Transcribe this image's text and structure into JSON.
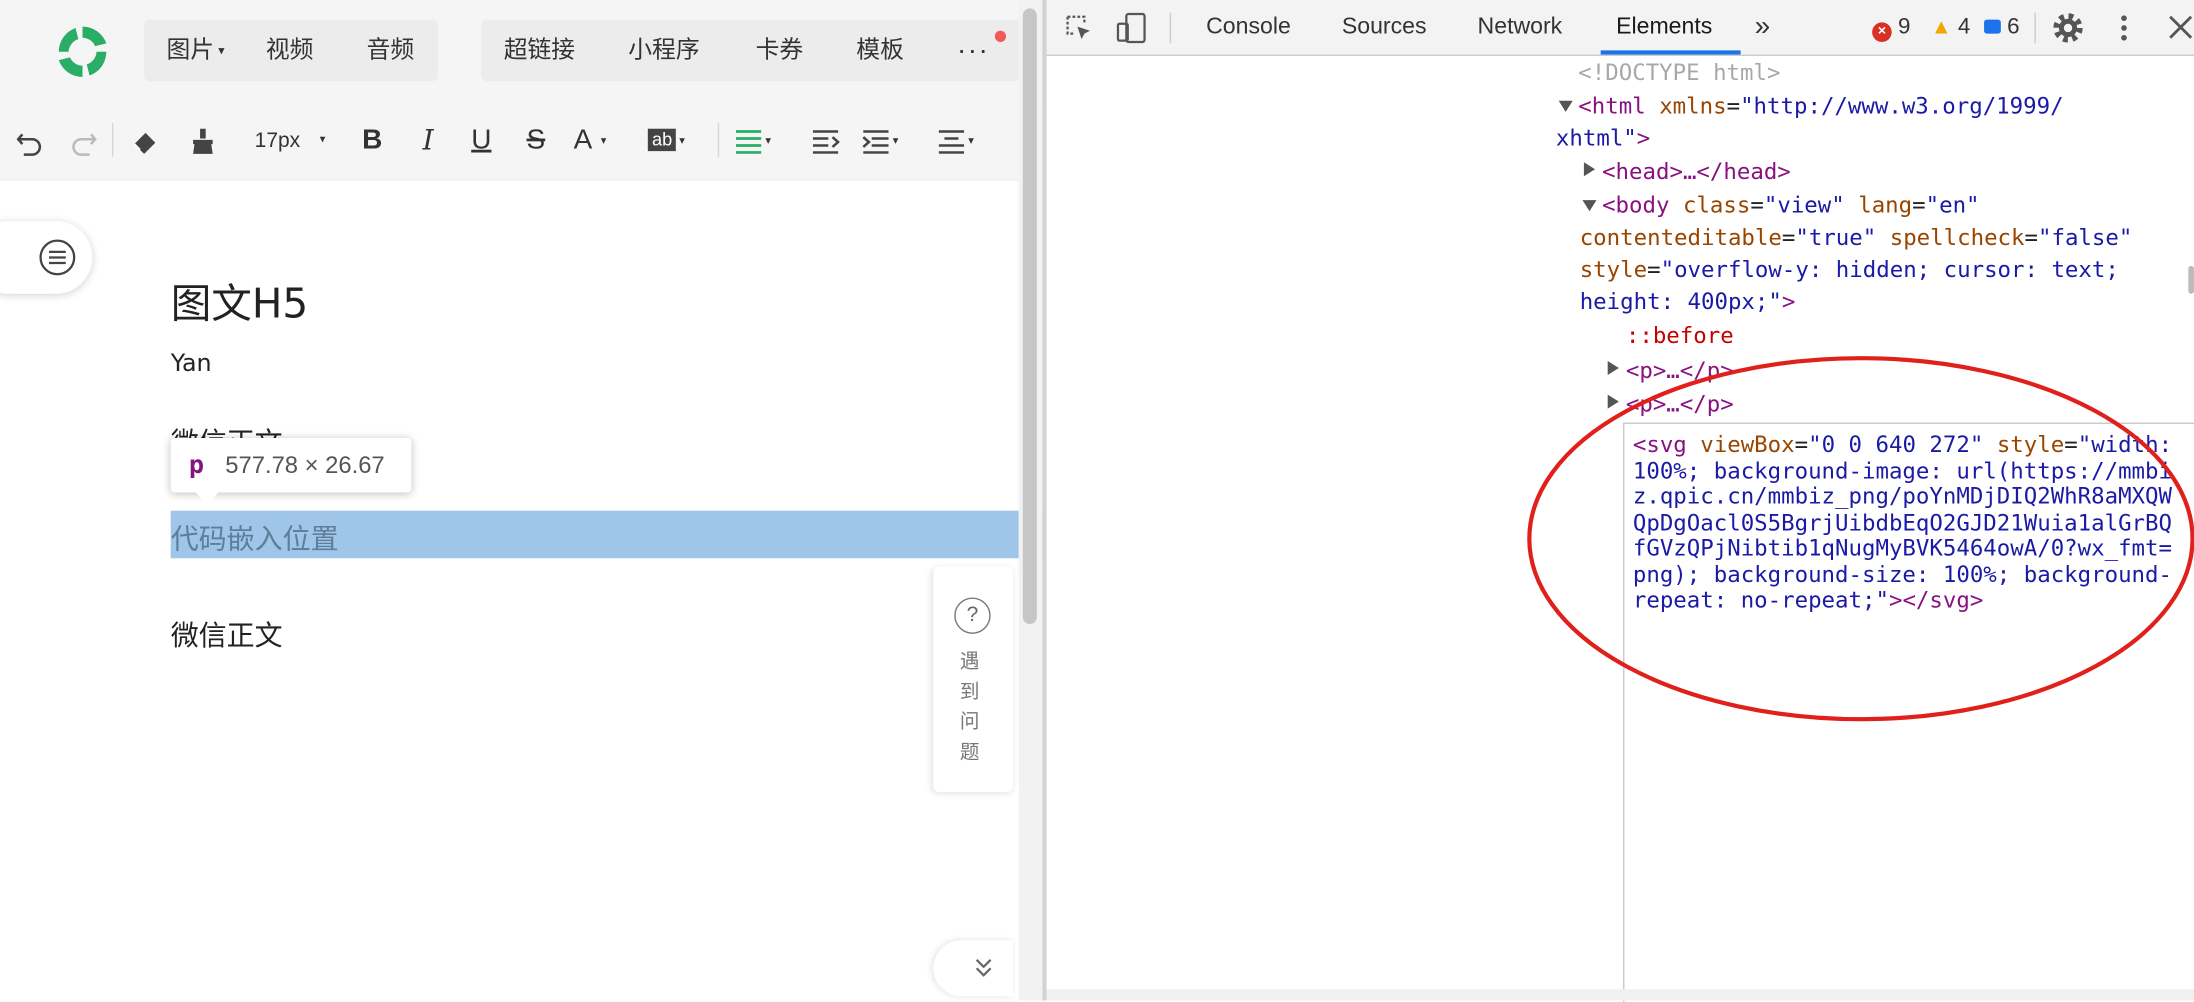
{
  "editor": {
    "menu1": [
      {
        "label": "图片",
        "has_caret": true
      },
      {
        "label": "视频"
      },
      {
        "label": "音频"
      }
    ],
    "menu2": [
      {
        "label": "超链接"
      },
      {
        "label": "小程序"
      },
      {
        "label": "卡券"
      },
      {
        "label": "模板"
      }
    ],
    "more": "···",
    "toolbar": {
      "font_size": "17px"
    },
    "doc": {
      "title": "图文H5",
      "author": "Yan",
      "para1": "微信正文",
      "selected_para": "代码嵌入位置",
      "para3": "微信正文"
    },
    "tooltip": {
      "tag": "p",
      "dims": "577.78 × 26.67"
    },
    "help": {
      "icon": "?",
      "text": "遇到问题"
    }
  },
  "devtools": {
    "tabs": [
      "Console",
      "Sources",
      "Network",
      "Elements"
    ],
    "active_tab": "Elements",
    "more_tabs": "»",
    "errors": "9",
    "warnings": "4",
    "messages": "6",
    "dom": {
      "doctype": "<!DOCTYPE html>",
      "html_open": "<html",
      "html_attr": "xmlns",
      "html_val_1": "\"http://www.w3.org/1999/",
      "html_val_2": "xhtml\"",
      "gt": ">",
      "head": "<head>…</head>",
      "body_open": "<body",
      "body_class_attr": "class",
      "body_class_val": "\"view\"",
      "body_lang_attr": "lang",
      "body_lang_val": "\"en\"",
      "body_ce_attr": "contenteditable",
      "body_ce_val": "\"true\"",
      "body_sc_attr": "spellcheck",
      "body_sc_val": "\"false\"",
      "body_style_attr": "style",
      "body_style_val_1": "\"overflow-y: hidden; cursor: text;",
      "body_style_val_2": "height: 400px;\"",
      "before": "::before",
      "p_collapsed": "<p>…</p>",
      "svg_open": "<svg",
      "svg_vb_attr": "viewBox",
      "svg_vb_val": "\"0 0 640 272\"",
      "svg_style_attr": "style",
      "svg_style_val": "\"width: 100%; background-image: url(https://mmbiz.qpic.cn/mmbiz_png/poYnMDjDIQ2WhR8aMXQWQpDgOacl0S5BgrjUibdbEqO2GJD21Wuia1alGrBQfGVzQPjNibtib1qNugMyBVK5464owA/0?wx_fmt=png); background-size: 100%; background-repeat: no-repeat;\"",
      "svg_close": "></svg>"
    }
  },
  "colors": {
    "brand_green": "#2aae67",
    "selection": "#9fc5e8",
    "annotation_red": "#e0201b",
    "active_tab_underline": "#1a73e8",
    "tag": "#881280",
    "attr_name": "#994500",
    "attr_value": "#1a1aa6"
  },
  "icons": [
    "logo-icon",
    "undo-icon",
    "redo-icon",
    "eraser-icon",
    "format-brush-icon",
    "bold-icon",
    "italic-icon",
    "underline-icon",
    "strikethrough-icon",
    "font-color-icon",
    "highlight-icon",
    "align-icon",
    "indent-icon",
    "line-height-icon",
    "outline-icon",
    "help-icon",
    "double-chevron-down-icon",
    "inspect-icon",
    "device-icon",
    "settings-icon",
    "more-vertical-icon",
    "close-icon"
  ]
}
